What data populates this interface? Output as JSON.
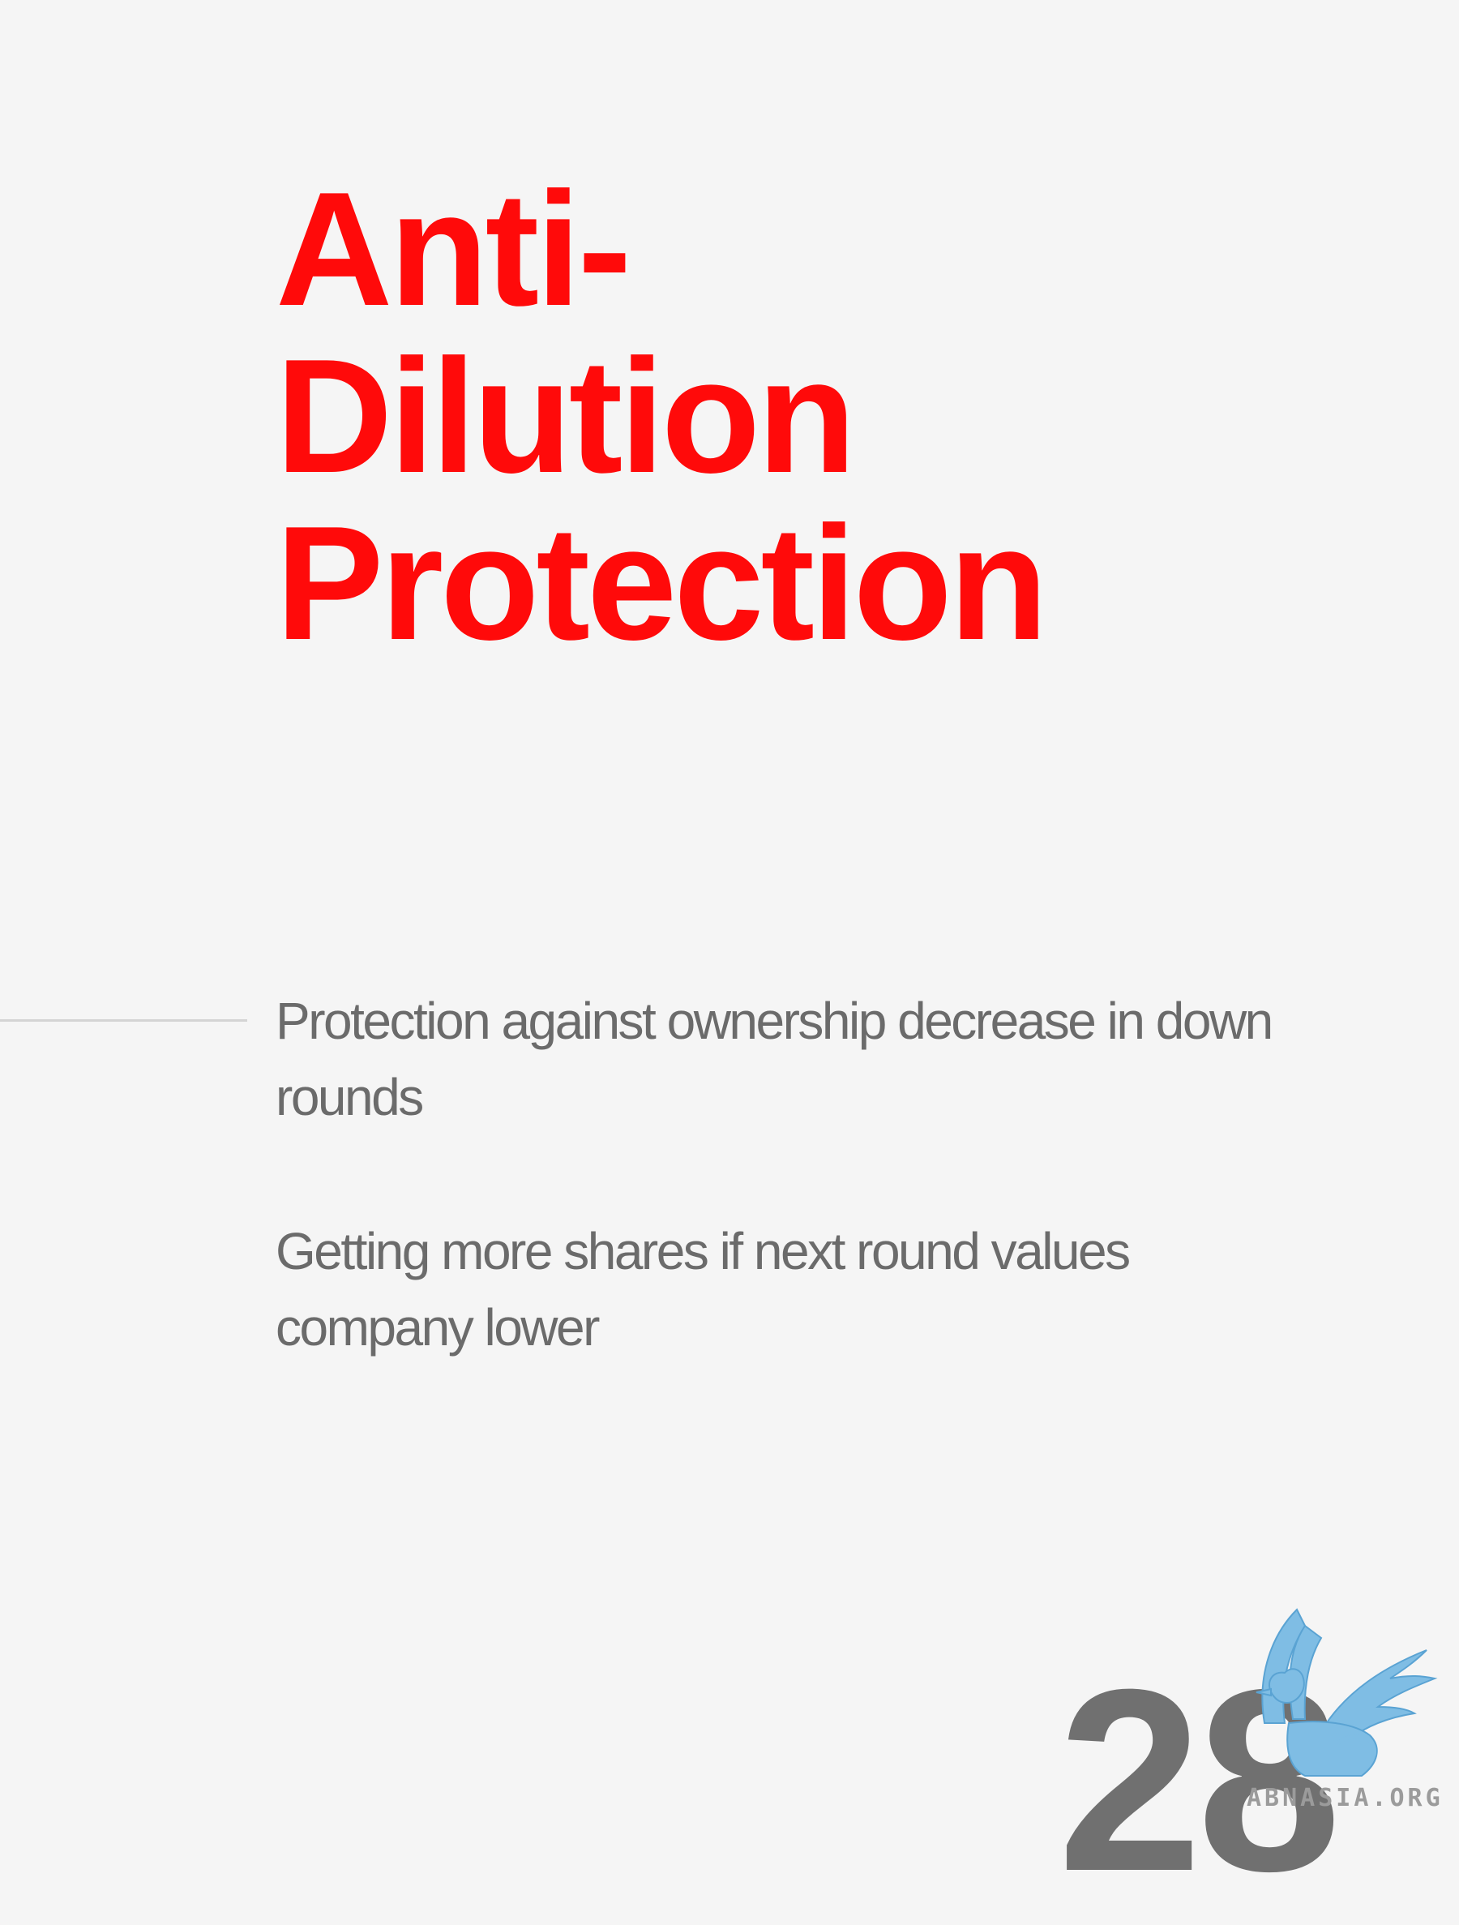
{
  "title": {
    "line1": "Anti-",
    "line2": "Dilution",
    "line3": "Protection"
  },
  "paragraphs": {
    "p1": "Protection against ownership decrease in down rounds",
    "p2": "Getting more shares if next round values company lower"
  },
  "page_number": "28",
  "watermark": {
    "text": "ABNASIA.ORG",
    "icon": "griffin-icon"
  },
  "colors": {
    "background": "#f5f5f5",
    "title": "#ff0a0a",
    "body_text": "#6b6b6b",
    "page_number": "#707070",
    "logo": "#7fbde4"
  }
}
